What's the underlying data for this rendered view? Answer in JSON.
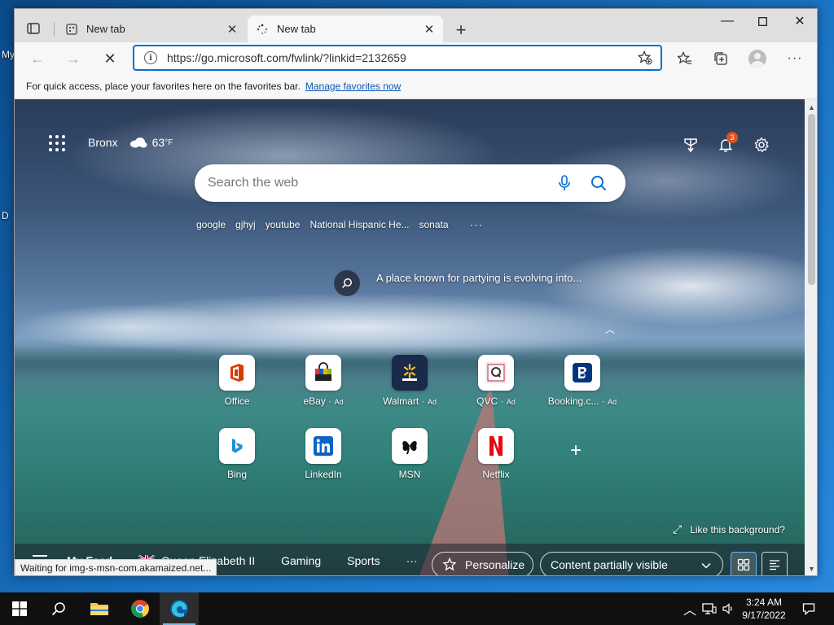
{
  "desktop": {
    "icon_labels": [
      "My",
      "D"
    ]
  },
  "browser": {
    "tabs": [
      {
        "label": "New tab",
        "active": false
      },
      {
        "label": "New tab",
        "active": true
      }
    ],
    "address": {
      "url": "https://go.microsoft.com/fwlink/?linkid=2132659"
    },
    "favorites_bar": {
      "message": "For quick access, place your favorites here on the favorites bar.",
      "link": "Manage favorites now"
    },
    "status": "Waiting for img-s-msn-com.akamaized.net..."
  },
  "ntp": {
    "weather": {
      "location": "Bronx",
      "temp": "63",
      "unit": "°F"
    },
    "notification_count": "3",
    "search": {
      "placeholder": "Search the web"
    },
    "trending": [
      "google",
      "gjhyj",
      "youtube",
      "National Hispanic He...",
      "sonata"
    ],
    "trending_more": "···",
    "headline": "A place known for partying is evolving into...",
    "tiles": [
      {
        "label": "Office",
        "ad": ""
      },
      {
        "label": "eBay",
        "ad": "Ad"
      },
      {
        "label": "Walmart",
        "ad": "Ad"
      },
      {
        "label": "QVC",
        "ad": "Ad"
      },
      {
        "label": "Booking.c...",
        "ad": "Ad"
      },
      {
        "label": "Bing",
        "ad": ""
      },
      {
        "label": "LinkedIn",
        "ad": ""
      },
      {
        "label": "MSN",
        "ad": ""
      },
      {
        "label": "Netflix",
        "ad": ""
      }
    ],
    "like_background": "Like this background?",
    "feed": {
      "items": [
        "My Feed",
        "Queen Elizabeth II",
        "Gaming",
        "Sports"
      ],
      "more": "···",
      "personalize": "Personalize",
      "content_visibility": "Content partially visible"
    }
  },
  "taskbar": {
    "time": "3:24 AM",
    "date": "9/17/2022"
  },
  "colors": {
    "accent": "#0a6ed1",
    "taskbar": "#101010",
    "badge": "#e0531f",
    "netflix": "#e50914",
    "office": "#d83b01",
    "booking": "#003580",
    "linkedin": "#0a66c2"
  }
}
